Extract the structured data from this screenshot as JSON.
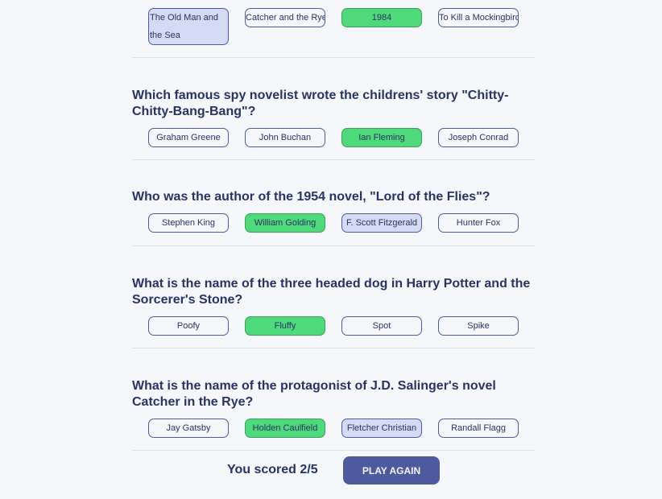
{
  "questions": [
    {
      "question": "",
      "answers": [
        {
          "label": "The Old Man and the Sea",
          "state": "selected-wrong"
        },
        {
          "label": "Catcher and the Rye",
          "state": "neutral"
        },
        {
          "label": "1984",
          "state": "correct"
        },
        {
          "label": "To Kill a Mockingbird",
          "state": "neutral"
        }
      ]
    },
    {
      "question": "Which famous spy novelist wrote the childrens' story \"Chitty-Chitty-Bang-Bang\"?",
      "answers": [
        {
          "label": "Graham Greene",
          "state": "neutral"
        },
        {
          "label": "John Buchan",
          "state": "neutral"
        },
        {
          "label": "Ian Fleming",
          "state": "correct"
        },
        {
          "label": "Joseph Conrad",
          "state": "neutral"
        }
      ]
    },
    {
      "question": "Who was the author of the 1954 novel, \"Lord of the Flies\"?",
      "answers": [
        {
          "label": "Stephen King",
          "state": "neutral"
        },
        {
          "label": "William Golding",
          "state": "correct"
        },
        {
          "label": "F. Scott Fitzgerald",
          "state": "selected-wrong"
        },
        {
          "label": "Hunter Fox",
          "state": "neutral"
        }
      ]
    },
    {
      "question": "What is the name of the three headed dog in Harry Potter and the Sorcerer's Stone?",
      "answers": [
        {
          "label": "Poofy",
          "state": "neutral"
        },
        {
          "label": "Fluffy",
          "state": "correct"
        },
        {
          "label": "Spot",
          "state": "neutral"
        },
        {
          "label": "Spike",
          "state": "neutral"
        }
      ]
    },
    {
      "question": "What is the name of the protagonist of J.D. Salinger's novel Catcher in the Rye?",
      "answers": [
        {
          "label": "Jay Gatsby",
          "state": "neutral"
        },
        {
          "label": "Holden Caulfield",
          "state": "correct"
        },
        {
          "label": "Fletcher Christian",
          "state": "selected-wrong"
        },
        {
          "label": "Randall Flagg",
          "state": "neutral"
        }
      ]
    }
  ],
  "footer": {
    "score_text": "You scored 2/5",
    "play_again_label": "PLAY AGAIN"
  },
  "colors": {
    "background": "#F5F7FB",
    "text": "#293264",
    "correct": "#4ED97A",
    "selected_wrong": "#D6DBF5",
    "button": "#4D5B9E"
  }
}
